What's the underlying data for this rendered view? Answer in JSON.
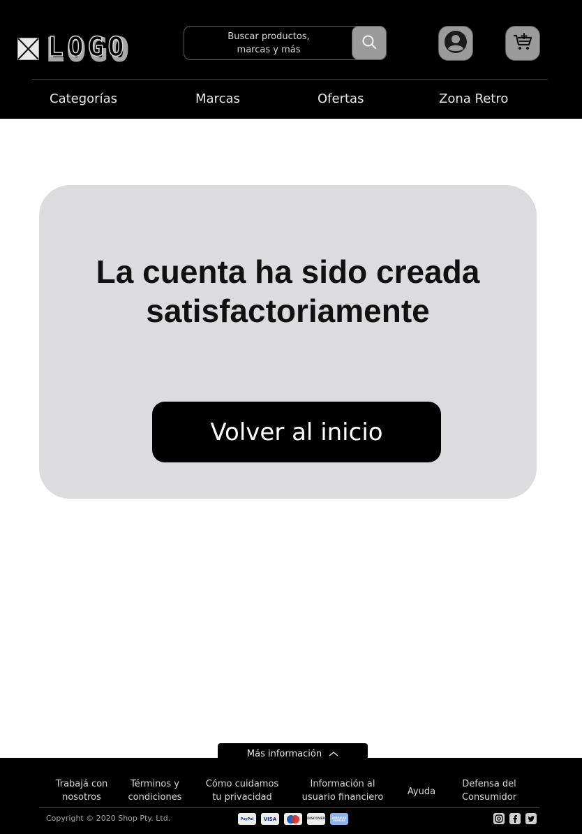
{
  "header": {
    "logo_text": "LOGO",
    "search": {
      "placeholder": "Buscar productos, marcas y más",
      "icon": "search-icon"
    },
    "user_icon": "user-icon",
    "cart_icon": "cart-add-icon",
    "nav": [
      {
        "label": "Categorías"
      },
      {
        "label": "Marcas"
      },
      {
        "label": "Ofertas"
      },
      {
        "label": "Zona Retro"
      }
    ]
  },
  "main": {
    "title": "La cuenta ha sido creada satisfactoriamente",
    "home_button": "Volver al inicio"
  },
  "footer": {
    "more_info": "Más información",
    "more_info_icon": "chevron-up-icon",
    "links": [
      {
        "label": "Trabajá con\nnosotros"
      },
      {
        "label": "Términos y\ncondiciones"
      },
      {
        "label": "Cómo cuidamos\ntu privacidad"
      },
      {
        "label": "Información al\nusuario financiero"
      },
      {
        "label": "Ayuda"
      },
      {
        "label": "Defensa del\nConsumidor"
      }
    ],
    "copyright": "Copyright © 2020 Shop Pty. Ltd.",
    "payments": [
      "PayPal",
      "VISA",
      "Maestro",
      "DISCOVER",
      "AMERICAN EXPRESS"
    ],
    "socials": [
      "instagram-icon",
      "facebook-icon",
      "twitter-icon"
    ]
  },
  "colors": {
    "header_bg": "#000000",
    "card_bg": "#dcdcde",
    "button_bg": "#000000",
    "icon_button_bg": "#9b9b9b"
  }
}
